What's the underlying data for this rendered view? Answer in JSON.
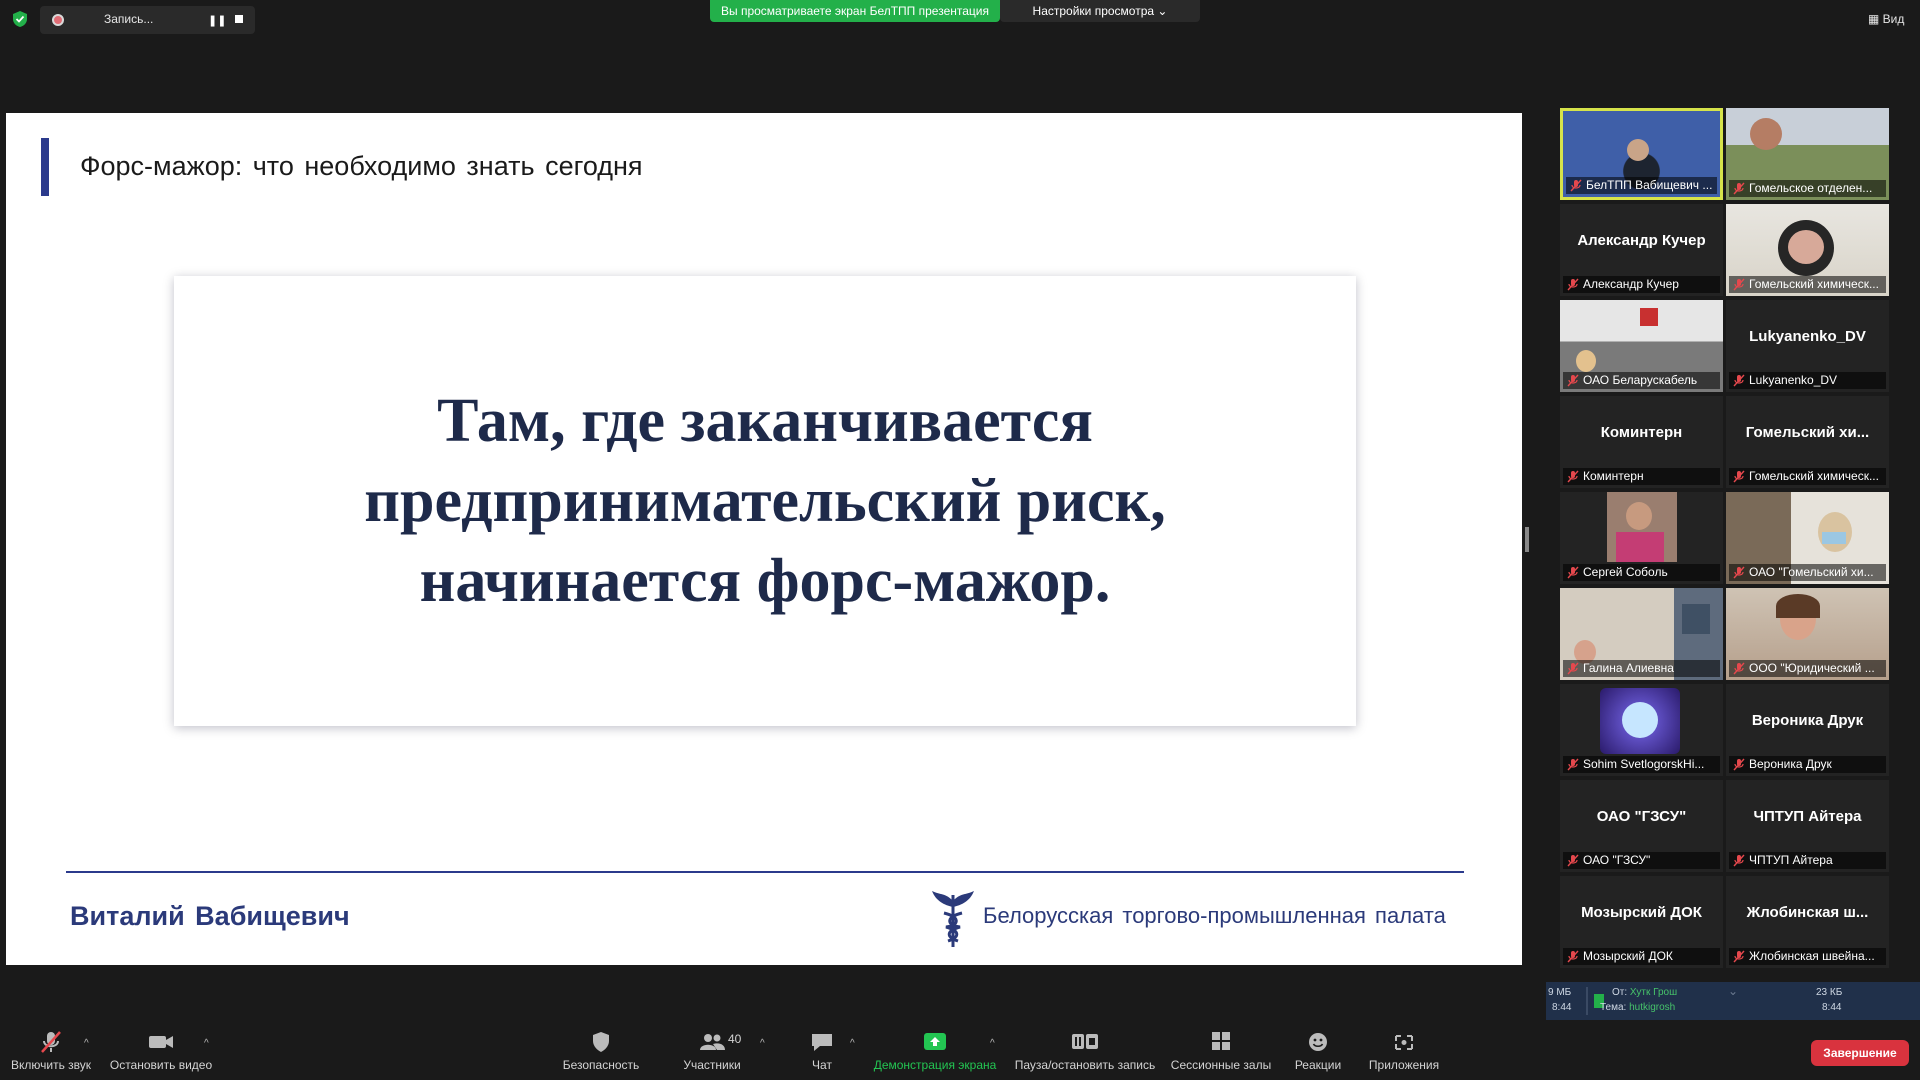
{
  "top": {
    "recording_label": "Запись...",
    "share_banner": "Вы просматриваете экран БелТПП презентация",
    "view_settings": "Настройки просмотра ⌄",
    "view_button": "Вид"
  },
  "slide": {
    "title": "Форс-мажор: что необходимо знать сегодня",
    "quote_line1": "Там, где заканчивается",
    "quote_line2": "предпринимательский риск,",
    "quote_line3": "начинается форс-мажор.",
    "speaker": "Виталий Вабищевич",
    "organization": "Белорусская торгово-промышленная палата"
  },
  "gallery": [
    {
      "label": "БелТПП Вабищевич ...",
      "big": "",
      "video": true,
      "active": true
    },
    {
      "label": "Гомельское отделен...",
      "big": "",
      "video": true
    },
    {
      "label": "Александр Кучер",
      "big": "Александр Кучер",
      "video": false
    },
    {
      "label": "Гомельский химическ...",
      "big": "",
      "video": true
    },
    {
      "label": "ОАО Беларускабель",
      "big": "",
      "video": true
    },
    {
      "label": "Lukyanenko_DV",
      "big": "Lukyanenko_DV",
      "video": false
    },
    {
      "label": "Коминтерн",
      "big": "Коминтерн",
      "video": false
    },
    {
      "label": "Гомельский химическ...",
      "big": "Гомельский хи...",
      "video": false
    },
    {
      "label": "Сергей Соболь",
      "big": "",
      "video": true
    },
    {
      "label": "ОАО \"Гомельский хи...",
      "big": "",
      "video": true
    },
    {
      "label": "Галина Алиевна",
      "big": "",
      "video": true
    },
    {
      "label": "ООО \"Юридический ...",
      "big": "",
      "video": true
    },
    {
      "label": "Sohim SvetlogorskHi...",
      "big": "",
      "video": true
    },
    {
      "label": "Вероника Друк",
      "big": "Вероника Друк",
      "video": false
    },
    {
      "label": "ОАО \"ГЗСУ\"",
      "big": "ОАО \"ГЗСУ\"",
      "video": false
    },
    {
      "label": "ЧПТУП Айтера",
      "big": "ЧПТУП Айтера",
      "video": false
    },
    {
      "label": "Мозырский ДОК",
      "big": "Мозырский ДОК",
      "video": false
    },
    {
      "label": "Жлобинская швейна...",
      "big": "Жлобинская ш...",
      "video": false
    }
  ],
  "chat_mini": {
    "left_size": "9 МБ",
    "left_time": "8:44",
    "from_label": "От:",
    "from_value": "Хутк Грош",
    "subject_label": "Тема:",
    "subject_value": "hutkigrosh",
    "right_size": "23 КБ",
    "right_time": "8:44"
  },
  "toolbar": {
    "unmute": "Включить звук",
    "stop_video": "Остановить видео",
    "security": "Безопасность",
    "participants": "Участники",
    "participants_count": "40",
    "chat": "Чат",
    "share": "Демонстрация экрана",
    "pause_record": "Пауза/остановить запись",
    "breakout": "Сессионные залы",
    "reactions": "Реакции",
    "apps": "Приложения",
    "end": "Завершение"
  },
  "colors": {
    "share_green": "#23b04a",
    "slide_accent": "#2b3a8c",
    "end_red": "#d9333e",
    "active_speaker": "#d6e34a"
  }
}
